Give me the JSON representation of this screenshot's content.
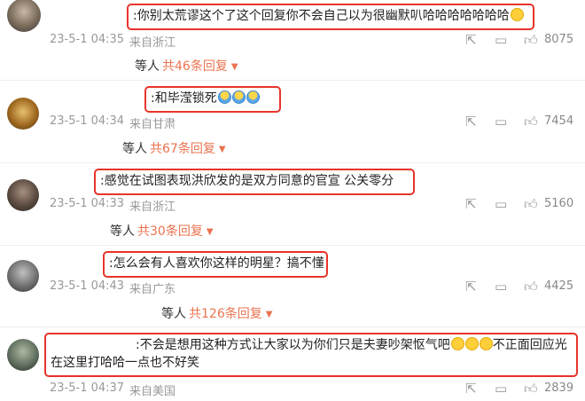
{
  "comments": [
    {
      "text": ":你别太荒谬这个了这个回复你不会自己以为很幽默叭哈哈哈哈哈哈哈",
      "emojis": [
        "face-emoji"
      ],
      "date": "23-5-1 04:35",
      "location": "来自浙江",
      "likes": "8075",
      "reply_prefix": "等人",
      "reply_link": "共46条回复"
    },
    {
      "text": ":和毕滢锁死",
      "emojis": [
        "hug-emoji",
        "hug-emoji",
        "hug-emoji"
      ],
      "date": "23-5-1 04:34",
      "location": "来自甘肃",
      "likes": "7454",
      "reply_prefix": "等人",
      "reply_link": "共67条回复"
    },
    {
      "text": ":感觉在试图表现洪欣发的是双方同意的官宣 公关零分",
      "emojis": [],
      "date": "23-5-1 04:33",
      "location": "来自浙江",
      "likes": "5160",
      "reply_prefix": "等人",
      "reply_link": "共30条回复"
    },
    {
      "text": ":怎么会有人喜欢你这样的明星？搞不懂",
      "emojis": [],
      "date": "23-5-1 04:43",
      "location": "来自广东",
      "likes": "4425",
      "reply_prefix": "等人",
      "reply_link": "共126条回复"
    },
    {
      "text_line1": ":不会是想用这种方式让大家以为你们只是夫妻吵架怄气吧",
      "text_line1_tail": "不正面回应光",
      "text_line2": "在这里打哈哈一点也不好笑",
      "emojis": [
        "smirk-emoji",
        "smirk-emoji",
        "smirk-emoji"
      ],
      "date": "23-5-1 04:37",
      "location": "来自美国",
      "likes": "2839"
    }
  ],
  "icons": {
    "share": "share-icon",
    "comment": "comment-icon",
    "like": "like-icon"
  },
  "colors": {
    "highlight_border": "#e8342a",
    "reply_link": "#eb7350",
    "meta_text": "#999999"
  }
}
